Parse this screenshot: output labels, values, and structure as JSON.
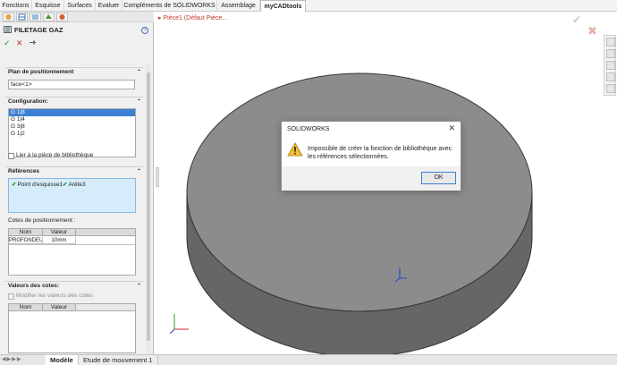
{
  "ribbon": {
    "tabs": [
      {
        "label": "Fonctions"
      },
      {
        "label": "Esquisse"
      },
      {
        "label": "Surfaces"
      },
      {
        "label": "Evaluer"
      },
      {
        "label": "Compléments de SOLIDWORKS"
      },
      {
        "label": "Assemblage"
      },
      {
        "label": "myCADtools",
        "active": true
      }
    ]
  },
  "property_manager": {
    "title": "FILETAGE GAZ",
    "help_icon": "question-icon",
    "actions": {
      "ok": "✓",
      "cancel": "✕",
      "pin": "pin-icon"
    },
    "plan_positionnement": {
      "heading": "Plan de positionnement",
      "value": "face<1>"
    },
    "configuration": {
      "heading": "Configuration:",
      "items": [
        "G 1|8",
        "G 1|4",
        "G 3|8",
        "G 1|2"
      ],
      "selected_index": 0
    },
    "lier_bibliotheque": "Lier à la pièce de bibliothèque",
    "references": {
      "heading": "Références",
      "items": [
        "Point d'esquisse1",
        "Arête3"
      ]
    },
    "cotes_positionnement": {
      "label": "Cotes de positionnement :",
      "columns": [
        "Nom",
        "Valeur"
      ],
      "rows": [
        [
          "PROFONDEU",
          "10mm"
        ]
      ]
    },
    "valeurs_cotes": {
      "heading": "Valeurs des cotes:",
      "modifier_label": "Modifier les valeurs des cotes",
      "columns": [
        "Nom",
        "Valeur"
      ]
    }
  },
  "viewport": {
    "tree_label": "Pièce1 (Défaut Pièce..."
  },
  "dialog": {
    "title": "SOLIDWORKS",
    "close": "✕",
    "message": "Impossible de créer la fonction de bibliothèque avec les références sélectionnées.",
    "ok_label": "OK",
    "icon": "warning-icon"
  },
  "bottom_tabs": [
    {
      "label": "Modèle",
      "active": true
    },
    {
      "label": "Etude de mouvement 1"
    }
  ],
  "colors": {
    "selection": "#3c80d3",
    "reference_box": "#d7ecfb",
    "part_face": "#8c8c8c",
    "part_side": "#6e6e6e"
  }
}
